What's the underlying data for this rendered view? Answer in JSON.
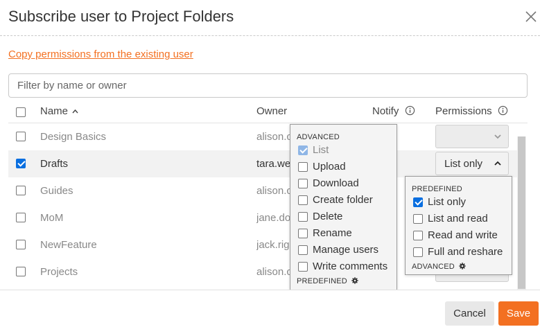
{
  "dialog": {
    "title": "Subscribe user to Project Folders",
    "copy_link": "Copy permissions from the existing user",
    "filter_placeholder": "Filter by name or owner"
  },
  "table": {
    "headers": {
      "name": "Name",
      "owner": "Owner",
      "notify": "Notify",
      "permissions": "Permissions"
    },
    "sort_indicator": "^",
    "rows": [
      {
        "name": "Design Basics",
        "owner": "alison.c",
        "checked": false
      },
      {
        "name": "Drafts",
        "owner": "tara.we",
        "checked": true,
        "permission": "List only"
      },
      {
        "name": "Guides",
        "owner": "alison.c",
        "checked": false
      },
      {
        "name": "MoM",
        "owner": "jane.do",
        "checked": false
      },
      {
        "name": "NewFeature",
        "owner": "jack.rig",
        "checked": false
      },
      {
        "name": "Projects",
        "owner": "alison.c",
        "checked": false
      }
    ]
  },
  "advanced_popup": {
    "section_advanced": "ADVANCED",
    "options": [
      {
        "label": "List",
        "checked": true,
        "disabled": true
      },
      {
        "label": "Upload",
        "checked": false
      },
      {
        "label": "Download",
        "checked": false
      },
      {
        "label": "Create folder",
        "checked": false
      },
      {
        "label": "Delete",
        "checked": false
      },
      {
        "label": "Rename",
        "checked": false
      },
      {
        "label": "Manage users",
        "checked": false
      },
      {
        "label": "Write comments",
        "checked": false
      }
    ],
    "section_predefined": "PREDEFINED"
  },
  "predefined_popup": {
    "section_predefined": "PREDEFINED",
    "options": [
      {
        "label": "List only",
        "checked": true
      },
      {
        "label": "List and read",
        "checked": false
      },
      {
        "label": "Read and write",
        "checked": false
      },
      {
        "label": "Full and reshare",
        "checked": false
      }
    ],
    "section_advanced": "ADVANCED"
  },
  "footer": {
    "cancel": "Cancel",
    "save": "Save"
  },
  "colors": {
    "accent": "#f37021",
    "checkbox": "#0a6fe0"
  },
  "icons": [
    "close-icon",
    "info-icon",
    "chevron-down-icon",
    "chevron-up-icon",
    "gear-icon"
  ]
}
